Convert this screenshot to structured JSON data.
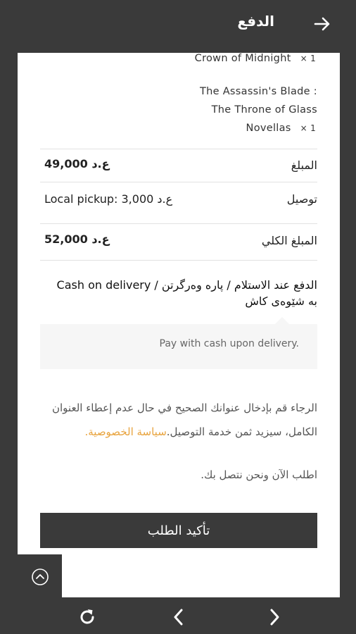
{
  "header": {
    "title": "الدفع",
    "back_icon": "arrow-right-icon"
  },
  "order_items": [
    {
      "lines": [
        "Crown of Midnight"
      ],
      "qty": "× 1"
    },
    {
      "lines": [
        "The Assassin's Blade :",
        "The Throne of Glass",
        "Novellas"
      ],
      "qty": "× 1"
    }
  ],
  "totals": {
    "subtotal_label": "المبلغ",
    "subtotal_value": "49,000 ع.د",
    "shipping_label": "توصيل",
    "shipping_value": "Local pickup: ع.د 3,000",
    "total_label": "المبلغ الكلي",
    "total_value": "52,000 ع.د"
  },
  "payment": {
    "method_title": "Cash on delivery / الدفع عند الاستلام / پارە وەرگرتن بە شێوەی کاش",
    "description": "Pay with cash upon delivery."
  },
  "notice": {
    "text": "الرجاء قم بإدخال عنوانك الصحيح في حال عدم إعطاء العنوان الكامل، سيزيد ثمن خدمة التوصيل.",
    "link": "سياسة الخصوصية.",
    "text2": "اطلب الآن ونحن نتصل بك."
  },
  "confirm_button": "تأكيد الطلب",
  "colors": {
    "bar": "#3a3a3a",
    "accent": "#e8a33d",
    "panel": "#ffffff"
  },
  "icons": {
    "scroll_top": "chevron-up-circle-icon",
    "reload": "reload-icon",
    "back": "chevron-left-icon",
    "forward": "chevron-right-icon"
  }
}
